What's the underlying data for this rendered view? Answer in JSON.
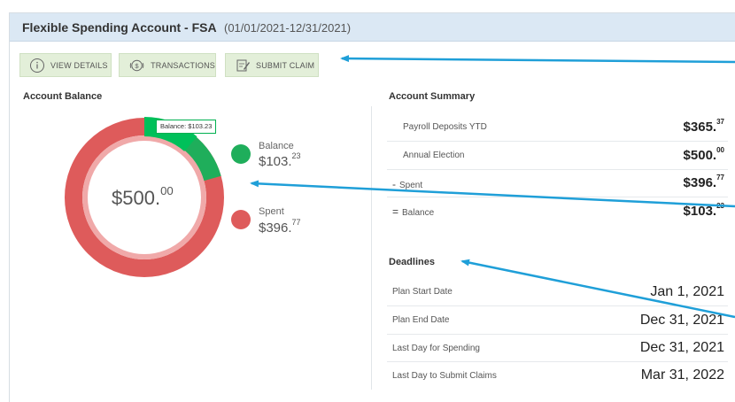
{
  "header": {
    "title": "Flexible Spending Account - FSA",
    "dates": "(01/01/2021-12/31/2021)"
  },
  "buttons": [
    {
      "label": "VIEW DETAILS",
      "icon": "info-icon"
    },
    {
      "label": "TRANSACTIONS",
      "icon": "dollar-icon"
    },
    {
      "label": "SUBMIT CLAIM",
      "icon": "claim-form-icon"
    }
  ],
  "account_balance": {
    "title": "Account Balance",
    "total": {
      "main": "$500.",
      "cents": "00"
    },
    "tooltip": "Balance: $103.23",
    "balance_fraction": 0.2065,
    "balance": {
      "label": "Balance",
      "main": "$103.",
      "cents": "23",
      "color": "#1fae5b"
    },
    "spent": {
      "label": "Spent",
      "main": "$396.",
      "cents": "77",
      "color": "#de5b5b"
    }
  },
  "summary": {
    "title": "Account Summary",
    "rows": [
      {
        "symbol": "",
        "label": "Payroll Deposits YTD",
        "main": "$365.",
        "cents": "37"
      },
      {
        "symbol": "",
        "label": "Annual Election",
        "main": "$500.",
        "cents": "00"
      },
      {
        "symbol": "-",
        "label": "Spent",
        "main": "$396.",
        "cents": "77"
      },
      {
        "symbol": "=",
        "label": "Balance",
        "main": "$103.",
        "cents": "23"
      }
    ]
  },
  "deadlines": {
    "title": "Deadlines",
    "rows": [
      {
        "label": "Plan Start Date",
        "value": "Jan 1, 2021"
      },
      {
        "label": "Plan End Date",
        "value": "Dec 31, 2021"
      },
      {
        "label": "Last Day for Spending",
        "value": "Dec 31, 2021"
      },
      {
        "label": "Last Day to Submit Claims",
        "value": "Mar 31, 2022"
      }
    ]
  },
  "colors": {
    "header_bg": "#dbe8f4",
    "button_bg": "#e3efd9",
    "arrow": "#1f9fd8",
    "balance_green": "#00c05a",
    "spent_red": "#de5b5b"
  }
}
